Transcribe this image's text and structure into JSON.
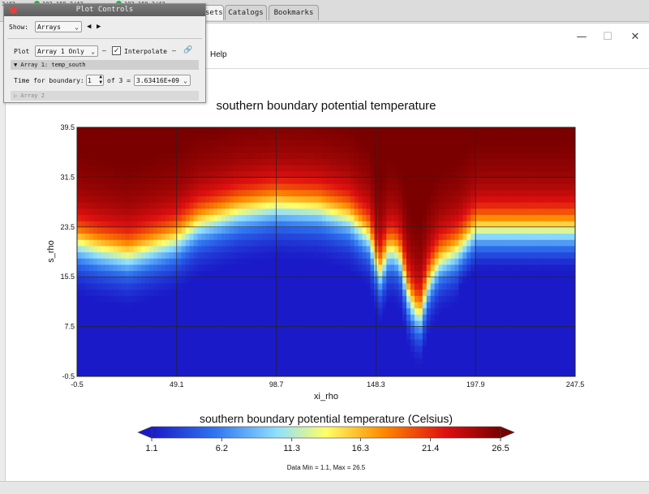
{
  "topbar": {
    "tabs": [
      "Datasets",
      "Catalogs",
      "Bookmarks"
    ],
    "ip_left": "3/43",
    "ip_mid": "192.168.3/43",
    "ip_right": "192.168.3/43"
  },
  "window": {
    "controls": {
      "minimize": "—",
      "maximize": "☐",
      "close": "✕"
    },
    "menu": [
      "Help"
    ]
  },
  "plot_controls": {
    "title": "Plot Controls",
    "show_label": "Show:",
    "show_value": "Arrays",
    "prev_arrow": "◀",
    "next_arrow": "▶",
    "plot_label": "Plot",
    "plot_value": "Array 1 Only",
    "dash1": "—",
    "interpolate_label": "Interpolate",
    "interpolate_checked": true,
    "dash2": "—",
    "link_icon": "link-icon",
    "array1_header": "▼ Array 1: temp_south",
    "time_label": "Time for boundary:",
    "time_index": "1",
    "of_text": "of 3 =",
    "time_value": "3.63416E+09",
    "array2_header": "▷ Array 2"
  },
  "plot": {
    "title": "southern boundary potential temperature",
    "x_label": "xi_rho",
    "y_label": "s_rho",
    "x_ticks": [
      "-0.5",
      "49.1",
      "98.7",
      "148.3",
      "197.9",
      "247.5"
    ],
    "y_ticks": [
      "-0.5",
      "7.5",
      "15.5",
      "23.5",
      "31.5",
      "39.5"
    ],
    "colorbar_title": "southern boundary potential temperature (Celsius)",
    "colorbar_ticks": [
      "1.1",
      "6.2",
      "11.3",
      "16.3",
      "21.4",
      "26.5"
    ],
    "data_range": "Data Min = 1.1, Max = 26.5"
  },
  "chart_data": {
    "type": "heatmap",
    "title": "southern boundary potential temperature",
    "xlabel": "xi_rho",
    "ylabel": "s_rho",
    "xlim": [
      -0.5,
      247.5
    ],
    "ylim": [
      -0.5,
      39.5
    ],
    "x_ticks": [
      -0.5,
      49.1,
      98.7,
      148.3,
      197.9,
      247.5
    ],
    "y_ticks": [
      -0.5,
      7.5,
      15.5,
      23.5,
      31.5,
      39.5
    ],
    "colorbar": {
      "label": "southern boundary potential temperature (Celsius)",
      "min": 1.1,
      "max": 26.5,
      "ticks": [
        1.1,
        6.2,
        11.3,
        16.3,
        21.4,
        26.5
      ],
      "colors": [
        "#1e1ed0",
        "#2f74f0",
        "#8fe0ff",
        "#ffff66",
        "#ff8c00",
        "#e01010",
        "#7a0000"
      ]
    },
    "data_min": 1.1,
    "data_max": 26.5,
    "grid": true,
    "thermocline_depth_by_xi": {
      "xi": [
        -0.5,
        10,
        25,
        49.1,
        60,
        80,
        98.7,
        120,
        135,
        145,
        150,
        155,
        160,
        165,
        170,
        175,
        180,
        190,
        197.9,
        210,
        230,
        247.5
      ],
      "s_rho": [
        21,
        20,
        19,
        21.5,
        24,
        26,
        27,
        26.5,
        25,
        22,
        16,
        20,
        19,
        12,
        9,
        15,
        18,
        20,
        23,
        23,
        23,
        23
      ]
    }
  }
}
